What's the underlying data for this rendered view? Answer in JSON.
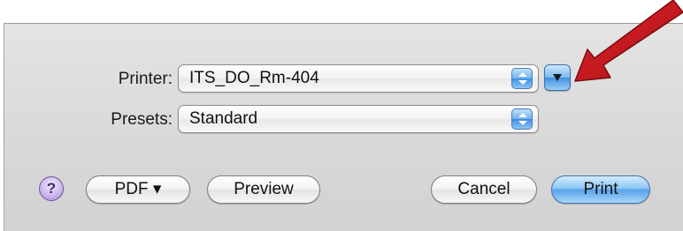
{
  "printer": {
    "label": "Printer:",
    "value": "ITS_DO_Rm-404"
  },
  "presets": {
    "label": "Presets:",
    "value": "Standard"
  },
  "buttons": {
    "help": "?",
    "pdf": "PDF ▾",
    "preview": "Preview",
    "cancel": "Cancel",
    "print": "Print"
  },
  "icons": {
    "help": "help-icon",
    "stepper": "up-down-arrows-icon",
    "disclosure": "disclosure-triangle-icon",
    "annotation": "red-arrow-annotation"
  },
  "colors": {
    "accent_blue": "#5aa6ea",
    "annotation_red": "#c8141b",
    "help_purple": "#c9b3ec"
  }
}
